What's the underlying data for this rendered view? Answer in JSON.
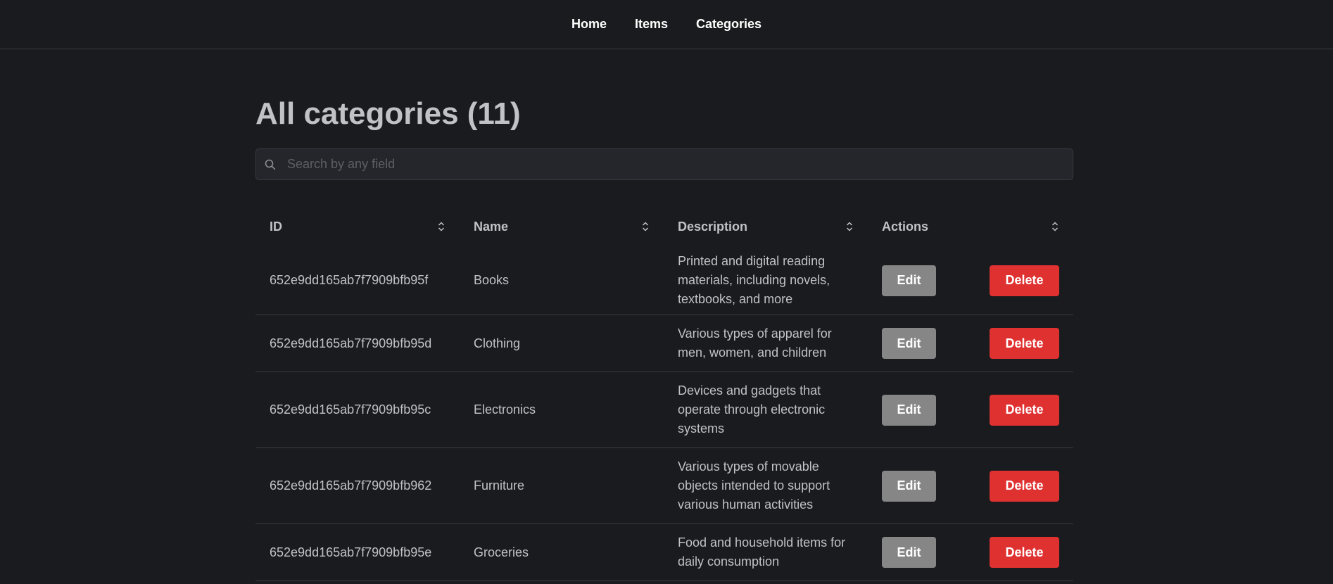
{
  "nav": {
    "items": [
      {
        "label": "Home"
      },
      {
        "label": "Items"
      },
      {
        "label": "Categories"
      }
    ]
  },
  "page": {
    "title": "All categories (11)"
  },
  "search": {
    "placeholder": "Search by any field",
    "value": ""
  },
  "table": {
    "columns": [
      {
        "label": "ID"
      },
      {
        "label": "Name"
      },
      {
        "label": "Description"
      },
      {
        "label": "Actions"
      }
    ],
    "edit_label": "Edit",
    "delete_label": "Delete",
    "rows": [
      {
        "id": "652e9dd165ab7f7909bfb95f",
        "name": "Books",
        "description": "Printed and digital reading materials, including novels, textbooks, and more"
      },
      {
        "id": "652e9dd165ab7f7909bfb95d",
        "name": "Clothing",
        "description": "Various types of apparel for men, women, and children"
      },
      {
        "id": "652e9dd165ab7f7909bfb95c",
        "name": "Electronics",
        "description": "Devices and gadgets that operate through electronic systems"
      },
      {
        "id": "652e9dd165ab7f7909bfb962",
        "name": "Furniture",
        "description": "Various types of movable objects intended to support various human activities"
      },
      {
        "id": "652e9dd165ab7f7909bfb95e",
        "name": "Groceries",
        "description": "Food and household items for daily consumption"
      }
    ]
  },
  "colors": {
    "background": "#1a1b1e",
    "edit_button": "#868686",
    "delete_button": "#e03131"
  },
  "icons": {
    "search": "search-icon",
    "sort": "sort-icon"
  }
}
